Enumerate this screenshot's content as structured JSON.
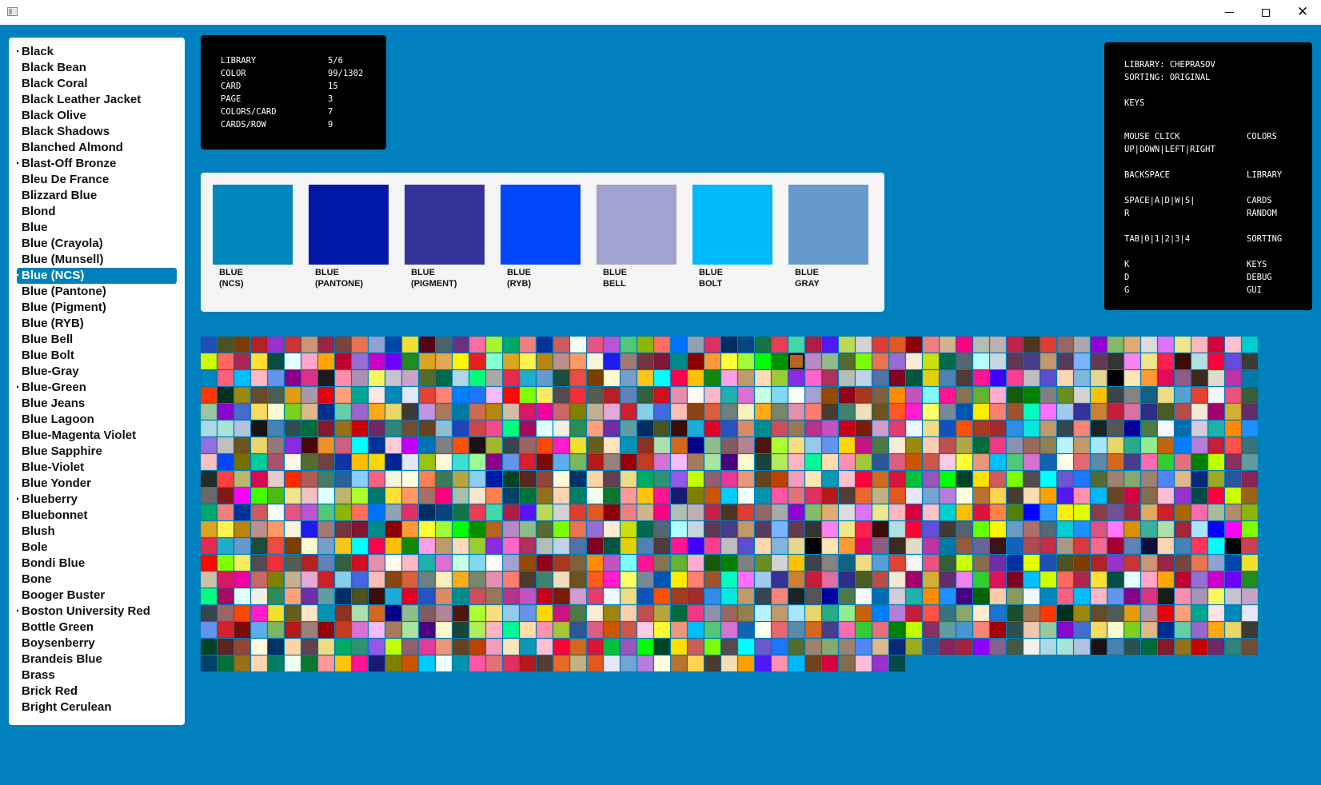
{
  "window": {
    "controls": {
      "minimize": "─",
      "maximize": "☐",
      "close": "✕"
    }
  },
  "colors": {
    "background": "#0080bc",
    "active_item": "#0080bc"
  },
  "sidebar": {
    "active_index": 14,
    "items": [
      {
        "label": "Black",
        "marked": true
      },
      {
        "label": "Black Bean",
        "marked": false
      },
      {
        "label": "Black Coral",
        "marked": false
      },
      {
        "label": "Black Leather Jacket",
        "marked": false
      },
      {
        "label": "Black Olive",
        "marked": false
      },
      {
        "label": "Black Shadows",
        "marked": false
      },
      {
        "label": "Blanched Almond",
        "marked": false
      },
      {
        "label": "Blast-Off Bronze",
        "marked": true
      },
      {
        "label": "Bleu De France",
        "marked": false
      },
      {
        "label": "Blizzard Blue",
        "marked": false
      },
      {
        "label": "Blond",
        "marked": false
      },
      {
        "label": "Blue",
        "marked": false
      },
      {
        "label": "Blue (Crayola)",
        "marked": false
      },
      {
        "label": "Blue (Munsell)",
        "marked": false
      },
      {
        "label": "Blue (NCS)",
        "marked": true
      },
      {
        "label": "Blue (Pantone)",
        "marked": false
      },
      {
        "label": "Blue (Pigment)",
        "marked": false
      },
      {
        "label": "Blue (RYB)",
        "marked": false
      },
      {
        "label": "Blue Bell",
        "marked": false
      },
      {
        "label": "Blue Bolt",
        "marked": false
      },
      {
        "label": "Blue-Gray",
        "marked": false
      },
      {
        "label": "Blue-Green",
        "marked": true
      },
      {
        "label": "Blue Jeans",
        "marked": false
      },
      {
        "label": "Blue Lagoon",
        "marked": false
      },
      {
        "label": "Blue-Magenta Violet",
        "marked": false
      },
      {
        "label": "Blue Sapphire",
        "marked": false
      },
      {
        "label": "Blue-Violet",
        "marked": false
      },
      {
        "label": "Blue Yonder",
        "marked": false
      },
      {
        "label": "Blueberry",
        "marked": true
      },
      {
        "label": "Bluebonnet",
        "marked": false
      },
      {
        "label": "Blush",
        "marked": false
      },
      {
        "label": "Bole",
        "marked": false
      },
      {
        "label": "Bondi Blue",
        "marked": false
      },
      {
        "label": "Bone",
        "marked": false
      },
      {
        "label": "Booger Buster",
        "marked": false
      },
      {
        "label": "Boston University Red",
        "marked": true
      },
      {
        "label": "Bottle Green",
        "marked": false
      },
      {
        "label": "Boysenberry",
        "marked": false
      },
      {
        "label": "Brandeis Blue",
        "marked": false
      },
      {
        "label": "Brass",
        "marked": false
      },
      {
        "label": "Brick Red",
        "marked": false
      },
      {
        "label": "Bright Cerulean",
        "marked": false
      }
    ]
  },
  "info": {
    "rows": [
      {
        "key": "LIBRARY",
        "value": "5/6"
      },
      {
        "key": "COLOR",
        "value": "99/1302"
      },
      {
        "key": "CARD",
        "value": "15"
      },
      {
        "key": "PAGE",
        "value": "3"
      },
      {
        "key": "COLORS/CARD",
        "value": "7"
      },
      {
        "key": "CARDS/ROW",
        "value": "9"
      }
    ]
  },
  "keys_panel": {
    "library_line": "LIBRARY: CHEPRASOV",
    "sorting_line": "SORTING: ORIGINAL",
    "title": "KEYS",
    "bindings": [
      {
        "keys": "MOUSE CLICK",
        "action": "COLORS"
      },
      {
        "keys": "UP|DOWN|LEFT|RIGHT",
        "action": ""
      },
      {
        "keys": "BACKSPACE",
        "action": "LIBRARY"
      },
      {
        "keys": "SPACE|A|D|W|S|",
        "action": "CARDS"
      },
      {
        "keys": "R",
        "action": "RANDOM"
      },
      {
        "keys": "TAB|0|1|2|3|4",
        "action": "SORTING"
      },
      {
        "keys": "K",
        "action": "KEYS"
      },
      {
        "keys": "D",
        "action": "DEBUG"
      },
      {
        "keys": "G",
        "action": "GUI"
      }
    ]
  },
  "card": {
    "swatches": [
      {
        "label": "BLUE\n(NCS)",
        "color": "#0087bd"
      },
      {
        "label": "BLUE\n(PANTONE)",
        "color": "#0018a8"
      },
      {
        "label": "BLUE\n(PIGMENT)",
        "color": "#333399"
      },
      {
        "label": "BLUE\n(RYB)",
        "color": "#0247fe"
      },
      {
        "label": "BLUE\nBELL",
        "color": "#a2a2d0"
      },
      {
        "label": "BLUE\nBOLT",
        "color": "#00b9fb"
      },
      {
        "label": "BLUE\nGRAY",
        "color": "#6699cc"
      }
    ]
  },
  "palette": {
    "columns": 63,
    "full_rows": 19,
    "last_row_count": 42,
    "selected": {
      "row": 1,
      "col": 35
    },
    "colors": [
      "#1f4fb3",
      "#a6b52e",
      "#7fb6e0",
      "#a7e6d7",
      "#b48ac8",
      "#5d8aa8",
      "#003399",
      "#6495ed",
      "#a40033",
      "#f2f0e6",
      "#f0e68c",
      "#7bd11c",
      "#e03c31",
      "#c46210",
      "#f4c2c2",
      "#e23d6e",
      "#a32638",
      "#ce2029",
      "#d7003d",
      "#00a693",
      "#ffc40c",
      "#ff8c00",
      "#fb607f",
      "#0054b4",
      "#8db600",
      "#fffaf0",
      "#b87333",
      "#556b2f",
      "#915f6d",
      "#e0115f",
      "#fff8dc",
      "#008000",
      "#5da130",
      "#ffdab9",
      "#00ffff",
      "#7fffd4",
      "#b2ec5d",
      "#4b5320",
      "#36454f",
      "#e6d690",
      "#b0c4de",
      "#8fbc8f",
      "#d2691e",
      "#cd5c5c",
      "#ffd700",
      "#6082b6",
      "#2e8b57",
      "#ff2052",
      "#deb887",
      "#e25822",
      "#0080ff",
      "#e0ffff",
      "#f0f8ff",
      "#a6e7ff",
      "#87ceeb",
      "#ffc0cb",
      "#ffe4e1",
      "#ff1493",
      "#1e90ff",
      "#f5f5dc",
      "#fdee00",
      "#e1ad21",
      "#ffb7c5",
      "#ffd54f",
      "#006a4e",
      "#e6399b",
      "#800020",
      "#40e0d0",
      "#808080",
      "#ff6347",
      "#9acd32",
      "#6a5acd",
      "#daa520",
      "#ffb6c1",
      "#7b3f00",
      "#996666",
      "#000000",
      "#1a1110",
      "#556b2f",
      "#483d8b",
      "#f5fffa",
      "#c71585",
      "#0e0e3d",
      "#ffa07a",
      "#3d0c02",
      "#00308f",
      "#8b0000",
      "#b57edc",
      "#bdb76b",
      "#f0dc82",
      "#0000ff",
      "#4169e1",
      "#00ced1",
      "#0087bd",
      "#191970",
      "#4b0082",
      "#ffffe0",
      "#fa8072",
      "#87cefa",
      "#20b2aa",
      "#483c32",
      "#add8e6",
      "#e9967a",
      "#00bfff",
      "#98fb98",
      "#6b8e23",
      "#9370db",
      "#8a2be2",
      "#1f75fe",
      "#fff44f",
      "#00fa9a",
      "#b22222",
      "#ff4500",
      "#ffe5b4",
      "#4682b4",
      "#7cfc00",
      "#ff69b4",
      "#e75480",
      "#4f7942",
      "#fdd5b1",
      "#6f2da8",
      "#b0e0e6",
      "#66cdaa",
      "#f08080",
      "#c41e3a",
      "#adff2f",
      "#0f52ba",
      "#ff00ff",
      "#fdbcb4",
      "#ffbf00",
      "#e6e6fa",
      "#808000",
      "#006400",
      "#ff7f50",
      "#a0522d",
      "#3cb371",
      "#da70d6",
      "#f5deb3",
      "#00ff7f",
      "#654321",
      "#ccff00",
      "#8b008b",
      "#d3d3d3",
      "#c0c0c0",
      "#ff66cc",
      "#556b2f",
      "#b8860b",
      "#ffdead",
      "#9932cc",
      "#ff1dce",
      "#ff9933",
      "#2f4f4f",
      "#e97451",
      "#32cd32",
      "#ba55d3",
      "#faebd7",
      "#4682b4",
      "#5f9ea0",
      "#ff0038",
      "#9966cc",
      "#d2b48c",
      "#ff5349",
      "#01796f",
      "#ff4f00",
      "#7fff00",
      "#8b4513",
      "#dc143c",
      "#e34234",
      "#cc5500",
      "#ffcba4",
      "#3b7a57",
      "#00ffbf",
      "#ffefd5",
      "#c9ffe5",
      "#ff9f00",
      "#a9a9a9",
      "#c04000",
      "#ff6961",
      "#6495ed",
      "#fcc200",
      "#6c541e",
      "#b03060",
      "#9f8170",
      "#bc8f8f",
      "#ff91af",
      "#cc3333",
      "#f0e130",
      "#e30b5c",
      "#006b3c",
      "#966fd6",
      "#e4717a",
      "#50c878",
      "#9b870c",
      "#ff355e",
      "#002e63",
      "#6050dc",
      "#ffa812",
      "#ff007f",
      "#36747d",
      "#ffe135",
      "#aa381e",
      "#2a52be",
      "#d9603b",
      "#ff8243",
      "#f88379",
      "#00ccff",
      "#8a9a5b",
      "#b5a642",
      "#ff6fff",
      "#a52a2a",
      "#80daeb",
      "#5218fa",
      "#e52b50",
      "#f19cbb",
      "#ab274f",
      "#d3212d",
      "#3b444b",
      "#e9d66b",
      "#b2beb5",
      "#87a96b",
      "#ff9966",
      "#a4c639",
      "#cd9575",
      "#665d1e",
      "#915c83",
      "#841b2d",
      "#faebd7",
      "#008000",
      "#8db600",
      "#fbceb1",
      "#00ffff",
      "#4b5320",
      "#3b3c36",
      "#e9d66b",
      "#b2beb5",
      "#87a96b",
      "#ff9966",
      "#a52a2a",
      "#fdee00",
      "#6e7f80",
      "#568203",
      "#007fff",
      "#f0ffff",
      "#f0f8ff",
      "#89cff0",
      "#a1caf1",
      "#f4c2c2",
      "#fefefa",
      "#ff91af",
      "#21abcd",
      "#fae7b5",
      "#ffe135",
      "#7c0a02",
      "#848482",
      "#98777b",
      "#bcd4e6",
      "#9f8170",
      "#f5f5dc",
      "#2e5894",
      "#9c2542",
      "#ffe4c4",
      "#3d2b1f",
      "#967117",
      "#cae00d",
      "#bfff00",
      "#fe6f5e",
      "#bf4f51",
      "#000000",
      "#3d0c02",
      "#54626f",
      "#3b3c36",
      "#bfafb2",
      "#ffebcd",
      "#a57164",
      "#318ce7",
      "#ace5ee",
      "#faf0be",
      "#0000ff",
      "#1f75fe",
      "#0093af",
      "#0087bd",
      "#0018a8",
      "#333399",
      "#0247fe",
      "#a2a2d0",
      "#00b9fb",
      "#6699cc",
      "#0d98ba",
      "#064e40",
      "#5dadec",
      "#126180",
      "#8a2be2",
      "#5072a7",
      "#4f86f7",
      "#1c1cf0",
      "#de5d83",
      "#79443b",
      "#0095b6",
      "#e3dac9",
      "#cc0000",
      "#006a4e",
      "#873260",
      "#0070ff",
      "#b5a642",
      "#cb4154",
      "#1dacd6",
      "#66ff00",
      "#bf94e4",
      "#c32148",
      "#1974d2",
      "#ff007f",
      "#08e8de",
      "#d19fe8",
      "#ffaa1d",
      "#3399ff",
      "#f4bbff",
      "#ff55a3",
      "#fb607f",
      "#004225",
      "#cd7f32",
      "#737000",
      "#964b00",
      "#6b4423",
      "#1b4d3e",
      "#ffc1cc",
      "#e7feff",
      "#7bb661",
      "#f0dc82",
      "#480607",
      "#800020",
      "#deb887",
      "#a17a74",
      "#cc5500",
      "#e97451",
      "#8a3324",
      "#bd33a4",
      "#702963",
      "#536872",
      "#5f9ea0",
      "#91a3b0",
      "#006b3c",
      "#ed872d",
      "#e30022",
      "#fff600",
      "#a67b5b",
      "#4b3621",
      "#1e4d2b",
      "#a3c1ad",
      "#c19a6b",
      "#efbbcc",
      "#78866b",
      "#ffef00",
      "#ff0800",
      "#e4717a",
      "#00bfff",
      "#592720",
      "#c41e3a",
      "#00cc99",
      "#960018",
      "#d70040",
      "#eb4c42",
      "#ff0038",
      "#ffa6c9",
      "#b31b1b",
      "#56a0d3",
      "#ed9121",
      "#00563f",
      "#062a78",
      "#703642",
      "#c95a49",
      "#92a1cf",
      "#ace1af",
      "#007ba7",
      "#2f847c",
      "#b2ffff",
      "#4997d0",
      "#de3163",
      "#ec3b83",
      "#007ba7",
      "#2a52be",
      "#6d9bc3",
      "#007aa5",
      "#e03c31",
      "#a0785a",
      "#f7e7ce",
      "#36454f",
      "#232b2b",
      "#e68fac",
      "#dfff00",
      "#7fff00",
      "#de3163",
      "#ffb7c5",
      "#954535",
      "#de6fa1",
      "#a8516e",
      "#aa381e",
      "#856d4d",
      "#7b3f00",
      "#d2691e",
      "#ffa700",
      "#98817b",
      "#e34234",
      "#cd607e",
      "#e4d00a",
      "#9fa91f",
      "#7f1734",
      "#fbcce7",
      "#0047ab",
      "#d2691e",
      "#965a3e",
      "#6f4e37",
      "#c4d8e2",
      "#f88379",
      "#002e63",
      "#8c92ac",
      "#b87333",
      "#da8a67",
      "#ad6f69",
      "#cb6d51",
      "#996666",
      "#ff3800",
      "#ff7f50",
      "#f88379",
      "#ff4040",
      "#fd7c6e",
      "#893f45",
      "#fbec5d",
      "#b31b1b",
      "#6495ed",
      "#fff8dc",
      "#2e2d88",
      "#fff8e7",
      "#81613c",
      "#ffbcd9",
      "#fffdd0",
      "#dc143c",
      "#be0032",
      "#990000",
      "#f5f5f5",
      "#00ffff",
      "#4e82b4",
      "#28589c",
      "#008b8b",
      "#ffff31",
      "#f0e130",
      "#00008b",
      "#666699",
      "#654321",
      "#5d3954",
      "#a40000",
      "#08457e",
      "#986960",
      "#cd5b45",
      "#008b8b",
      "#536878",
      "#b8860b",
      "#a9a9a9",
      "#013220",
      "#00416a",
      "#1a2421",
      "#bdb76b",
      "#483c32",
      "#734f96",
      "#534b4f",
      "#543d37",
      "#8b008b",
      "#003366",
      "#4a5d23",
      "#556b2f",
      "#ff8c00",
      "#9932cc",
      "#779ecb",
      "#03c03c",
      "#966fd6",
      "#c23b22",
      "#e75480",
      "#003399",
      "#4f3a3c",
      "#872657",
      "#8b0000",
      "#e9967a",
      "#560319",
      "#8fbc8f",
      "#3c1414",
      "#8cbed6",
      "#483d8b",
      "#2f4f4f",
      "#177245",
      "#918151",
      "#ffa812",
      "#cc4e5c",
      "#00ced1",
      "#d1bea8",
      "#9400d3",
      "#9b870c",
      "#00703c",
      "#555555",
      "#d70a53",
      "#40826d",
      "#a9203e",
      "#ef3038",
      "#e9692c",
      "#da3287",
      "#fad6a5",
      "#b94e48",
      "#704241",
      "#c154c1",
      "#004b49",
      "#f5c71a",
      "#9955bb",
      "#cc00cc",
      "#d473d4",
      "#355e3b",
      "#ffcbdb",
      "#ff1493",
      "#a9203e",
      "#ff9933",
      "#00bfff",
      "#4a646c",
      "#7e5e60",
      "#1560bd",
      "#2243b6",
      "#c19a6b",
      "#edc9af",
      "#ea3c53",
      "#b9f2ff",
      "#696969",
      "#9b7653",
      "#1e90ff",
      "#d71868",
      "#85bb65",
      "#664c28",
      "#967117",
      "#00009c",
      "#e5ccc9",
      "#efdfbb",
      "#e1a95f",
      "#555d50",
      "#c2b280",
      "#1b1b1b",
      "#614051",
      "#f0ead6",
      "#1034a6",
      "#7df9ff",
      "#ff003f",
      "#00ffff",
      "#00ff00",
      "#6f00ff",
      "#f4bbff",
      "#ccff00",
      "#bf00ff",
      "#3f00ff",
      "#8f00ff",
      "#ffff33",
      "#50c878",
      "#6c3082",
      "#b48395",
      "#ab4b52",
      "#cc474b",
      "#563c5c",
      "#96c8a2",
      "#44d7a8",
      "#c19a6b",
      "#801818",
      "#b53389",
      "#de5285",
      "#f400a1",
      "#e5aa70",
      "#4d5d53",
      "#fdd5b1",
      "#4f7942",
      "#ff2800",
      "#6c541e",
      "#ce2029",
      "#b22222",
      "#e25822",
      "#fc8eac",
      "#eedc82",
      "#a2006d",
      "#ffbf00",
      "#ff1493",
      "#ccff00",
      "#ff004f",
      "#014421",
      "#228b22",
      "#a67b5b",
      "#856d4d",
      "#0072bb",
      "#fd3f92",
      "#86608e",
      "#9efd38",
      "#d473d4",
      "#fd6c9e",
      "#4e1609",
      "#c72c48",
      "#f64a8a",
      "#77b5fe",
      "#8806ce",
      "#ac1e44",
      "#a6e7ff",
      "#ff00ff",
      "#c154c1",
      "#ff77ff",
      "#cc6666",
      "#dcdcdc",
      "#e49b0f",
      "#007f66",
      "#f8f8ff",
      "#b05c52",
      "#fe5a1d",
      "#b06500",
      "#6082b6",
      "#e6e8fa",
      "#ab92b3",
      "#00ab66",
      "#d4af37",
      "#ffd700",
      "#85754e",
      "#996515",
      "#fcc200",
      "#ffdf00",
      "#daa520",
      "#a8e4a0",
      "#6f2da8",
      "#808080",
      "#bebebe",
      "#465945",
      "#00ff00",
      "#1164b4",
      "#a7f432",
      "#adff2f",
      "#a99a86",
      "#00ff7f",
      "#663854",
      "#446ccf",
      "#5218fa",
      "#e9d66b",
      "#3fff00",
      "#c90016",
      "#da9100",
      "#808000",
      "#df73ff",
      "#aa98a9",
      "#f0fff0",
      "#006db0",
      "#49796b",
      "#ff1dce",
      "#ff69b4",
      "#355e3b",
      "#71a6d2",
      "#fcf75e",
      "#319177",
      "#602f6b",
      "#002395",
      "#66b032",
      "#b2ec5d",
      "#138808",
      "#cd5c5c",
      "#e3a857",
      "#4b0082",
      "#002fa7",
      "#ff4f00",
      "#5a4fcf",
      "#f4f0ec",
      "#009000",
      "#fffff0",
      "#00a86b",
      "#f8de7e",
      "#d73b3e",
      "#a50b5e",
      "#343434",
      "#fada5e",
      "#bdda57",
      "#29ab87",
      "#4cbb17",
      "#7c1c05",
      "#3ab09e",
      "#c3b091",
      "#f0e68c",
      "#e8000d",
      "#087830",
      "#d6cadd",
      "#26619c",
      "#ffff66",
      "#a9ba9d",
      "#cf1020",
      "#b57edc",
      "#c4c3d0",
      "#9457eb",
      "#ee82ee",
      "#e6e6fa",
      "#fbaed2",
      "#967bb6",
      "#fba0e3",
      "#7cfc00",
      "#fff700",
      "#fffacd",
      "#e3ff00",
      "#1a1110",
      "#fdd5b1",
      "#add8e6",
      "#b5651d",
      "#e66771",
      "#f08080",
      "#93ccea",
      "#f56991",
      "#e0ffff",
      "#f984ef",
      "#fafad2",
      "#d3d3d3",
      "#90ee90",
      "#f0e68c",
      "#d39bcb",
      "#addfad",
      "#e6a8d7",
      "#ffb6c1",
      "#ffa07a",
      "#ff9999",
      "#20b2aa",
      "#87cefa",
      "#778899",
      "#b38b6d",
      "#e68fac",
      "#ffffe0",
      "#c8a2c8",
      "#bfff00",
      "#32cd32",
      "#9dc209",
      "#195905",
      "#faf0e6",
      "#c19a6b",
      "#534b4f",
      "#e62020",
      "#18453b"
    ]
  }
}
